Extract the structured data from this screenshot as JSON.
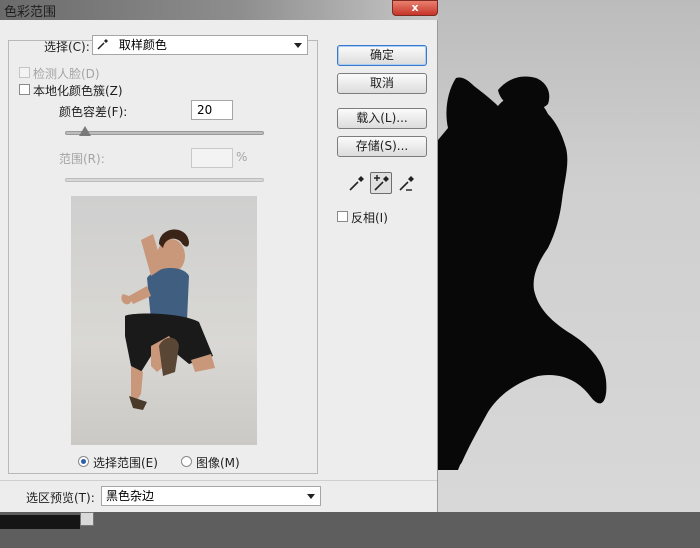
{
  "dialog": {
    "title": "色彩范围",
    "close_glyph": "x",
    "select": {
      "label": "选择(C):",
      "value": "取样颜色",
      "icon": "eyedropper-icon"
    },
    "detect_faces": {
      "label": "检测人脸(D)",
      "checked": false,
      "enabled": false
    },
    "localized_clusters": {
      "label": "本地化颜色簇(Z)",
      "checked": false
    },
    "fuzziness": {
      "label": "颜色容差(F):",
      "value": "20",
      "slider_fraction": 0.1
    },
    "range": {
      "label": "范围(R):",
      "value": "",
      "unit": "%",
      "enabled": false
    },
    "preview_mode": {
      "selection_label": "选择范围(E)",
      "image_label": "图像(M)",
      "selected": "selection"
    },
    "selection_preview": {
      "label": "选区预览(T):",
      "value": "黑色杂边"
    },
    "buttons": {
      "ok": "确定",
      "cancel": "取消",
      "load": "载入(L)...",
      "save": "存储(S)..."
    },
    "tools": [
      "eyedropper-icon",
      "eyedropper-plus-icon",
      "eyedropper-minus-icon"
    ],
    "active_tool": "eyedropper-plus-icon",
    "invert": {
      "label": "反相(I)",
      "checked": false
    }
  },
  "colors": {
    "dialog_bg": "#ededed",
    "default_button_border": "#3a78c9",
    "titlebar": "#8e8e8e",
    "close_button": "#c6362a",
    "canvas_bg": "#d8d8d8",
    "mask_black": "#080808"
  }
}
